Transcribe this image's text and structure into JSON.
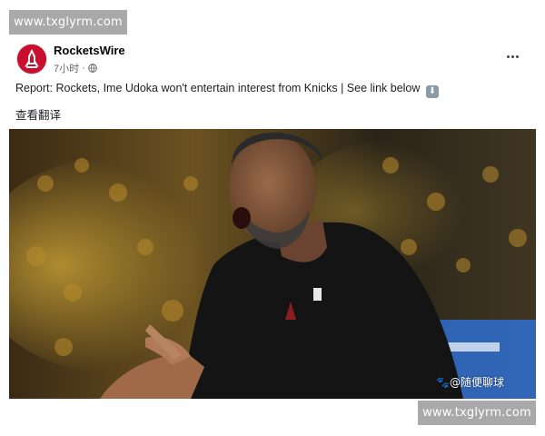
{
  "watermark": {
    "top": "www.txglyrm.com",
    "bottom": "www.txglyrm.com"
  },
  "post": {
    "page_name": "RocketsWire",
    "timestamp": "7小时",
    "separator": "·",
    "privacy_icon": "globe-icon",
    "text": "Report: Rockets, Ime Udoka won't entertain interest from Knicks | See link below",
    "emoji": "⬇",
    "translate_label": "查看翻译",
    "more_icon": "more-horizontal-icon"
  },
  "image": {
    "alt": "",
    "caption": "🐾@随便聊球"
  },
  "colors": {
    "brand_red": "#c8102e",
    "meta_gray": "#65676b",
    "watermark_gray": "#a9a9a9"
  }
}
